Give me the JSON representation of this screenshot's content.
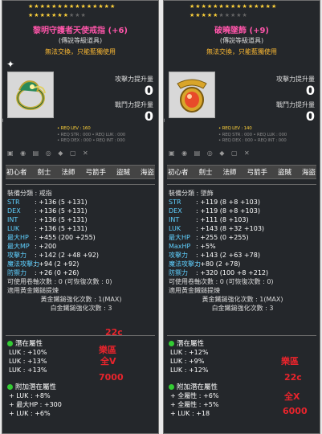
{
  "panels": [
    {
      "stars": [
        1,
        1,
        1,
        1,
        1,
        1,
        1,
        1,
        1,
        1,
        1,
        1,
        1,
        1,
        1,
        1,
        1,
        1,
        1,
        1,
        1,
        1,
        0,
        0,
        0
      ],
      "title": "黎明守護者天使戒指 (+6)",
      "grade": "(傳說等級道具)",
      "trade": "無法交換，只能藍獨使用",
      "attack_label": "攻擊力提升量",
      "attack_value": "0",
      "combat_label": "戰鬥力提升量",
      "combat_value": "0",
      "req_lev": "• REQ LEV : 160",
      "req_line1": "• REQ STR : 000   • REQ LUK : 000",
      "req_line2": "• REQ DEX : 000   • REQ INT : 000",
      "jobs": [
        "初心者",
        "劍士",
        "法師",
        "弓箭手",
        "盜賊",
        "海盜"
      ],
      "category": "裝備分類 : 戒指",
      "stats": [
        {
          "k": "STR",
          "v": ": +136 (5 +131)"
        },
        {
          "k": "DEX",
          "v": ": +136 (5 +131)"
        },
        {
          "k": "INT",
          "v": ": +136 (5 +131)"
        },
        {
          "k": "LUK",
          "v": ": +136 (5 +131)"
        },
        {
          "k": "最大HP",
          "v": ": +455 (200 +255)"
        },
        {
          "k": "最大MP",
          "v": ": +200"
        },
        {
          "k": "攻擊力",
          "v": ": +142 (2 +48 +92)"
        },
        {
          "k": "魔法攻擊力",
          "v": ": +94 (2 +92)"
        },
        {
          "k": "防禦力",
          "v": ": +26 (0 +26)"
        }
      ],
      "upgrades": "可使用卷軸次數 : 0 (可恢復次數 : 0)",
      "gold_hammer": "適用黃金鐵鎚提煉",
      "gold_times": "黃金鐵鎚強化次數 : 1(MAX)",
      "plat_times": "白金鐵鎚強化次數 : 3",
      "potential_header": "潛在屬性",
      "potential": [
        "LUK : +10%",
        "LUK : +13%",
        "LUK : +13%"
      ],
      "bonus_header": "附加潛在屬性",
      "bonus": [
        "+ LUK : +8%",
        "+ 最大HP : +300",
        "+ LUK : +6%"
      ],
      "notes": [
        {
          "text": "22c",
          "cls": "n1"
        },
        {
          "text": "樂區",
          "cls": "n2"
        },
        {
          "text": "全V",
          "cls": "n3"
        },
        {
          "text": "7000",
          "cls": "n4"
        }
      ]
    },
    {
      "stars": [
        1,
        1,
        1,
        1,
        1,
        1,
        1,
        1,
        1,
        1,
        1,
        1,
        1,
        1,
        1,
        1,
        1,
        1,
        1,
        1,
        0,
        0,
        0,
        0,
        0
      ],
      "title": "破曉墜飾 (+9)",
      "grade": "(傳說等級道具)",
      "trade": "無法交換，只能藍獨使用",
      "attack_label": "攻擊力提升量",
      "attack_value": "0",
      "combat_label": "戰鬥力提升量",
      "combat_value": "0",
      "req_lev": "• REQ LEV : 140",
      "req_line1": "• REQ STR : 000   • REQ LUK : 000",
      "req_line2": "• REQ DEX : 000   • REQ INT : 000",
      "jobs": [
        "初心者",
        "劍士",
        "法師",
        "弓箭手",
        "盜賊",
        "海盜"
      ],
      "category": "裝備分類 : 墜飾",
      "stats": [
        {
          "k": "STR",
          "v": ": +119 (8 +8 +103)"
        },
        {
          "k": "DEX",
          "v": ": +119 (8 +8 +103)"
        },
        {
          "k": "INT",
          "v": ": +111 (8 +103)"
        },
        {
          "k": "LUK",
          "v": ": +143 (8 +32 +103)"
        },
        {
          "k": "最大HP",
          "v": ": +255 (0 +255)"
        },
        {
          "k": "MaxHP",
          "v": ": +5%"
        },
        {
          "k": "攻擊力",
          "v": ": +143 (2 +63 +78)"
        },
        {
          "k": "魔法攻擊力",
          "v": ": +80 (2 +78)"
        },
        {
          "k": "防禦力",
          "v": ": +320 (100 +8 +212)"
        }
      ],
      "upgrades": "可使用卷軸次數 : 0 (可恢復次數 : 0)",
      "gold_hammer": "適用黃金鐵鎚提煉",
      "gold_times": "黃金鐵鎚強化次數 : 1(MAX)",
      "plat_times": "白金鐵鎚強化次數 : 3",
      "potential_header": "潛在屬性",
      "potential": [
        "LUK : +12%",
        "LUK : +9%",
        "LUK : +12%"
      ],
      "bonus_header": "附加潛在屬性",
      "bonus": [
        "+ 全屬性 : +6%",
        "+ 全屬性 : +5%",
        "+ LUK : +18"
      ],
      "notes": [
        {
          "text": "樂區",
          "cls": "m1"
        },
        {
          "text": "22c",
          "cls": "m2"
        },
        {
          "text": "全X",
          "cls": "m3"
        },
        {
          "text": "6000",
          "cls": "m4"
        }
      ]
    }
  ],
  "colors": {
    "title": "#ff55aa",
    "stat_label": "#5fd0ff",
    "bonus": "#33dd33",
    "gold": "#ffd23a",
    "note": "#e8242c"
  },
  "icons": {
    "ring": "ring-icon",
    "pendant": "pendant-icon",
    "hand": "pointer-hand-icon"
  }
}
